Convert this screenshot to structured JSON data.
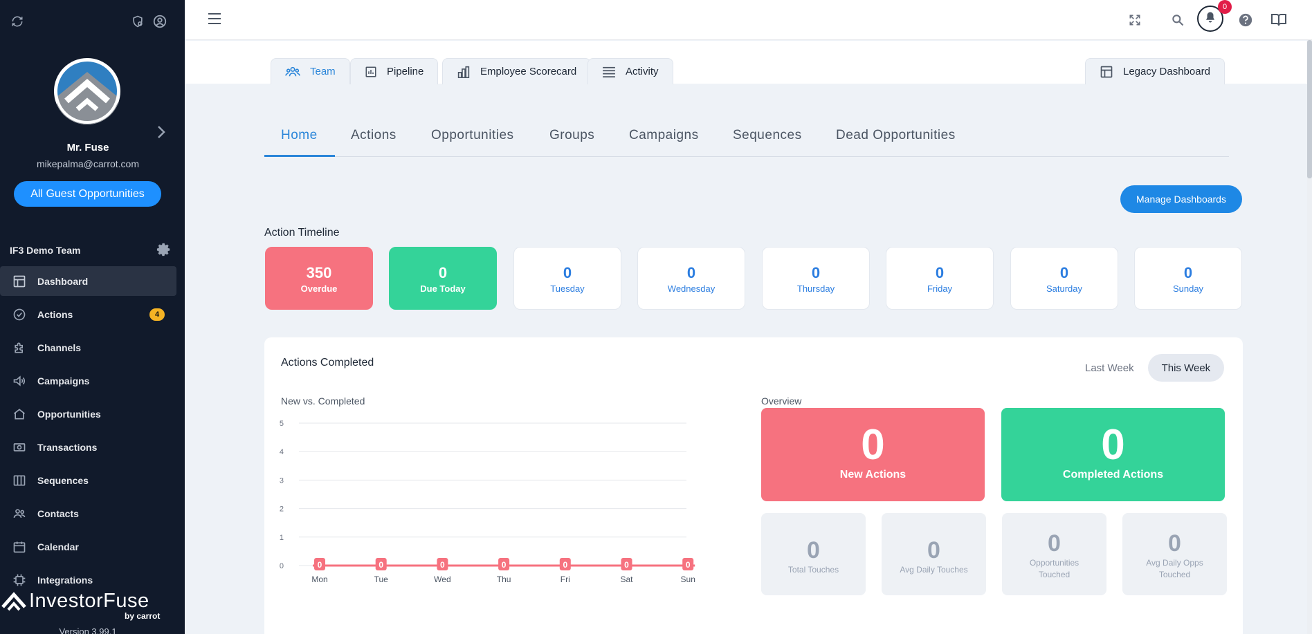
{
  "sidebar": {
    "user_name": "Mr. Fuse",
    "user_email": "mikepalma@carrot.com",
    "guest_button": "All Guest Opportunities",
    "team_name": "IF3 Demo Team",
    "items": [
      {
        "label": "Dashboard",
        "icon": "dashboard-icon",
        "active": true
      },
      {
        "label": "Actions",
        "icon": "check-circle-icon",
        "badge": "4"
      },
      {
        "label": "Channels",
        "icon": "puzzle-icon"
      },
      {
        "label": "Campaigns",
        "icon": "megaphone-icon"
      },
      {
        "label": "Opportunities",
        "icon": "house-icon"
      },
      {
        "label": "Transactions",
        "icon": "money-icon"
      },
      {
        "label": "Sequences",
        "icon": "columns-icon"
      },
      {
        "label": "Contacts",
        "icon": "people-icon"
      },
      {
        "label": "Calendar",
        "icon": "calendar-icon"
      },
      {
        "label": "Integrations",
        "icon": "chip-icon"
      }
    ],
    "brand": {
      "name": "InvestorFuse",
      "by": "by carrot"
    },
    "version": "Version 3.99.1"
  },
  "topbar": {
    "notification_count": "0"
  },
  "dashboard_tabs": [
    {
      "label": "Team",
      "icon": "team-icon",
      "active": true
    },
    {
      "label": "Pipeline",
      "icon": "chart-box-icon"
    },
    {
      "label": "Employee Scorecard",
      "icon": "bar-chart-icon"
    },
    {
      "label": "Activity",
      "icon": "list-icon"
    }
  ],
  "legacy_tab": {
    "label": "Legacy Dashboard",
    "icon": "layout-icon"
  },
  "subtabs": [
    "Home",
    "Actions",
    "Opportunities",
    "Groups",
    "Campaigns",
    "Sequences",
    "Dead Opportunities"
  ],
  "manage_button": "Manage Dashboards",
  "action_timeline": {
    "title": "Action Timeline",
    "cards": [
      {
        "value": "350",
        "label": "Overdue",
        "style": "red"
      },
      {
        "value": "0",
        "label": "Due Today",
        "style": "green"
      },
      {
        "value": "0",
        "label": "Tuesday"
      },
      {
        "value": "0",
        "label": "Wednesday"
      },
      {
        "value": "0",
        "label": "Thursday"
      },
      {
        "value": "0",
        "label": "Friday"
      },
      {
        "value": "0",
        "label": "Saturday"
      },
      {
        "value": "0",
        "label": "Sunday"
      }
    ]
  },
  "actions_completed": {
    "title": "Actions Completed",
    "toggle": [
      "Last Week",
      "This Week"
    ],
    "active_toggle": "This Week",
    "chart_title": "New vs. Completed",
    "overview_title": "Overview",
    "big_cards": [
      {
        "value": "0",
        "label": "New Actions",
        "color": "#f6727f"
      },
      {
        "value": "0",
        "label": "Completed Actions",
        "color": "#34d399"
      }
    ],
    "small_cards": [
      {
        "value": "0",
        "label": "Total Touches"
      },
      {
        "value": "0",
        "label": "Avg Daily Touches"
      },
      {
        "value": "0",
        "label": "Opportunities Touched"
      },
      {
        "value": "0",
        "label": "Avg Daily Opps Touched"
      }
    ]
  },
  "chart_data": {
    "type": "line",
    "categories": [
      "Mon",
      "Tue",
      "Wed",
      "Thu",
      "Fri",
      "Sat",
      "Sun"
    ],
    "series": [
      {
        "values": [
          0,
          0,
          0,
          0,
          0,
          0,
          0
        ],
        "color": "#f6727f"
      }
    ],
    "yticks": [
      0,
      1,
      2,
      3,
      4,
      5
    ],
    "ylim": [
      0,
      5
    ],
    "grid": true,
    "data_labels": true
  }
}
